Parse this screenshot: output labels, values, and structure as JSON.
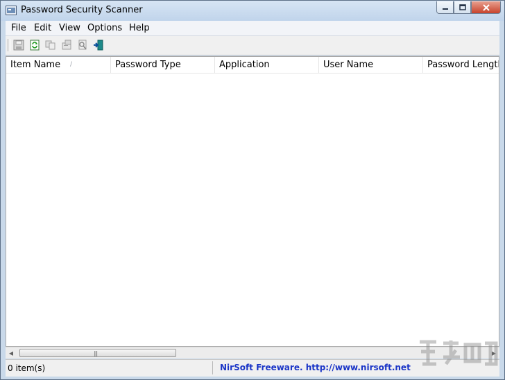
{
  "window": {
    "title": "Password Security Scanner"
  },
  "menu": {
    "items": [
      "File",
      "Edit",
      "View",
      "Options",
      "Help"
    ]
  },
  "toolbar": {
    "buttons": [
      {
        "icon": "save-icon"
      },
      {
        "icon": "refresh-icon"
      },
      {
        "icon": "copy-icon"
      },
      {
        "icon": "properties-icon"
      },
      {
        "icon": "find-icon"
      },
      {
        "icon": "exit-icon"
      }
    ]
  },
  "listview": {
    "columns": [
      "Item Name",
      "Password Type",
      "Application",
      "User Name",
      "Password Length"
    ],
    "sorted_column": "Item Name",
    "rows": []
  },
  "statusbar": {
    "count": "0 item(s)",
    "link": "NirSoft Freeware.  http://www.nirsoft.net"
  },
  "colors": {
    "link": "#1a35c7",
    "titlebar": "#c0d4eb",
    "close_button": "#c7432c"
  }
}
